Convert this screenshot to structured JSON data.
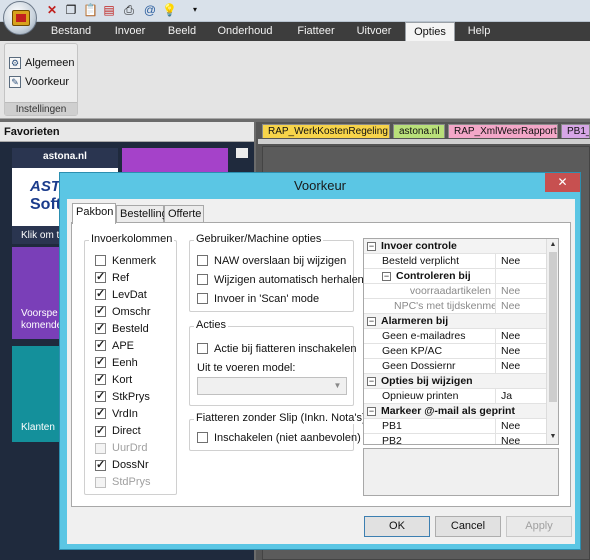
{
  "quick_access": [
    "delete-icon",
    "copy-icon",
    "paste-icon",
    "pdf-icon",
    "print-icon",
    "email-icon",
    "lightbulb-icon",
    "customize-dropdown-icon"
  ],
  "ribbon_tabs": [
    "Bestand",
    "Invoer",
    "Beeld",
    "Onderhoud",
    "Fiatteer",
    "Uitvoer",
    "Opties",
    "Help"
  ],
  "ribbon_active_tab": "Opties",
  "ribbon_group": {
    "buttons": [
      "Algemeen",
      "Voorkeur"
    ],
    "label": "Instellingen"
  },
  "favorites": {
    "header": "Favorieten",
    "tiles": {
      "astona_title": "astona.nl",
      "astona_logo_line1": "AST",
      "astona_logo_line2": "Soft",
      "astona_caption": "Klik om t",
      "voorspel_line1": "Voorspe",
      "voorspel_line2": "komende",
      "klanten": "Klanten"
    }
  },
  "doc_tabs": [
    "RAP_WerkKostenRegeling",
    "astona.nl",
    "RAP_XmlWeerRapport",
    "PB1_C"
  ],
  "dialog": {
    "title": "Voorkeur",
    "close": "✕",
    "tabs": [
      "Pakbon",
      "Bestelling",
      "Offerte"
    ],
    "invoerkolommen": {
      "legend": "Invoerkolommen",
      "items": [
        {
          "label": "Kenmerk",
          "checked": false,
          "enabled": true
        },
        {
          "label": "Ref",
          "checked": true,
          "enabled": true
        },
        {
          "label": "LevDat",
          "checked": true,
          "enabled": true
        },
        {
          "label": "Omschr",
          "checked": true,
          "enabled": true
        },
        {
          "label": "Besteld",
          "checked": true,
          "enabled": true
        },
        {
          "label": "APE",
          "checked": true,
          "enabled": true
        },
        {
          "label": "Eenh",
          "checked": true,
          "enabled": true
        },
        {
          "label": "Kort",
          "checked": true,
          "enabled": true
        },
        {
          "label": "StkPrys",
          "checked": true,
          "enabled": true
        },
        {
          "label": "VrdIn",
          "checked": true,
          "enabled": true
        },
        {
          "label": "Direct",
          "checked": true,
          "enabled": true
        },
        {
          "label": "UurDrd",
          "checked": false,
          "enabled": false
        },
        {
          "label": "DossNr",
          "checked": true,
          "enabled": true
        },
        {
          "label": "StdPrys",
          "checked": false,
          "enabled": false
        }
      ]
    },
    "gebruiker": {
      "legend": "Gebruiker/Machine opties",
      "items": [
        {
          "label": "NAW overslaan bij wijzigen",
          "checked": false
        },
        {
          "label": "Wijzigen automatisch herhalen",
          "checked": false
        },
        {
          "label": "Invoer in 'Scan' mode",
          "checked": false
        }
      ]
    },
    "acties": {
      "legend": "Acties",
      "checkbox": {
        "label": "Actie bij fiatteren inschakelen",
        "checked": false
      },
      "model_label": "Uit te voeren model:",
      "model_value": ""
    },
    "fiatteren": {
      "legend": "Fiatteren zonder Slip (Inkn. Nota's)",
      "checkbox": {
        "label": "Inschakelen (niet aanbevolen)",
        "checked": false
      }
    },
    "property_grid": [
      {
        "type": "cat",
        "label": "Invoer controle"
      },
      {
        "type": "row",
        "label": "Besteld verplicht",
        "value": "Nee"
      },
      {
        "type": "sub",
        "label": "Controleren bij"
      },
      {
        "type": "grey",
        "label": "voorraadartikelen",
        "value": "Nee"
      },
      {
        "type": "grey",
        "label": "NPC's met tijdskenmerk",
        "value": "Nee"
      },
      {
        "type": "cat",
        "label": "Alarmeren bij"
      },
      {
        "type": "row",
        "label": "Geen e-mailadres",
        "value": "Nee"
      },
      {
        "type": "row",
        "label": "Geen KP/AC",
        "value": "Nee"
      },
      {
        "type": "row",
        "label": "Geen Dossiernr",
        "value": "Nee"
      },
      {
        "type": "cat",
        "label": "Opties bij wijzigen"
      },
      {
        "type": "row",
        "label": "Opnieuw printen",
        "value": "Ja"
      },
      {
        "type": "cat",
        "label": "Markeer @-mail als geprint"
      },
      {
        "type": "row",
        "label": "PB1",
        "value": "Nee"
      },
      {
        "type": "row",
        "label": "PB2",
        "value": "Nee"
      }
    ],
    "buttons": {
      "ok": "OK",
      "cancel": "Cancel",
      "apply": "Apply"
    }
  }
}
